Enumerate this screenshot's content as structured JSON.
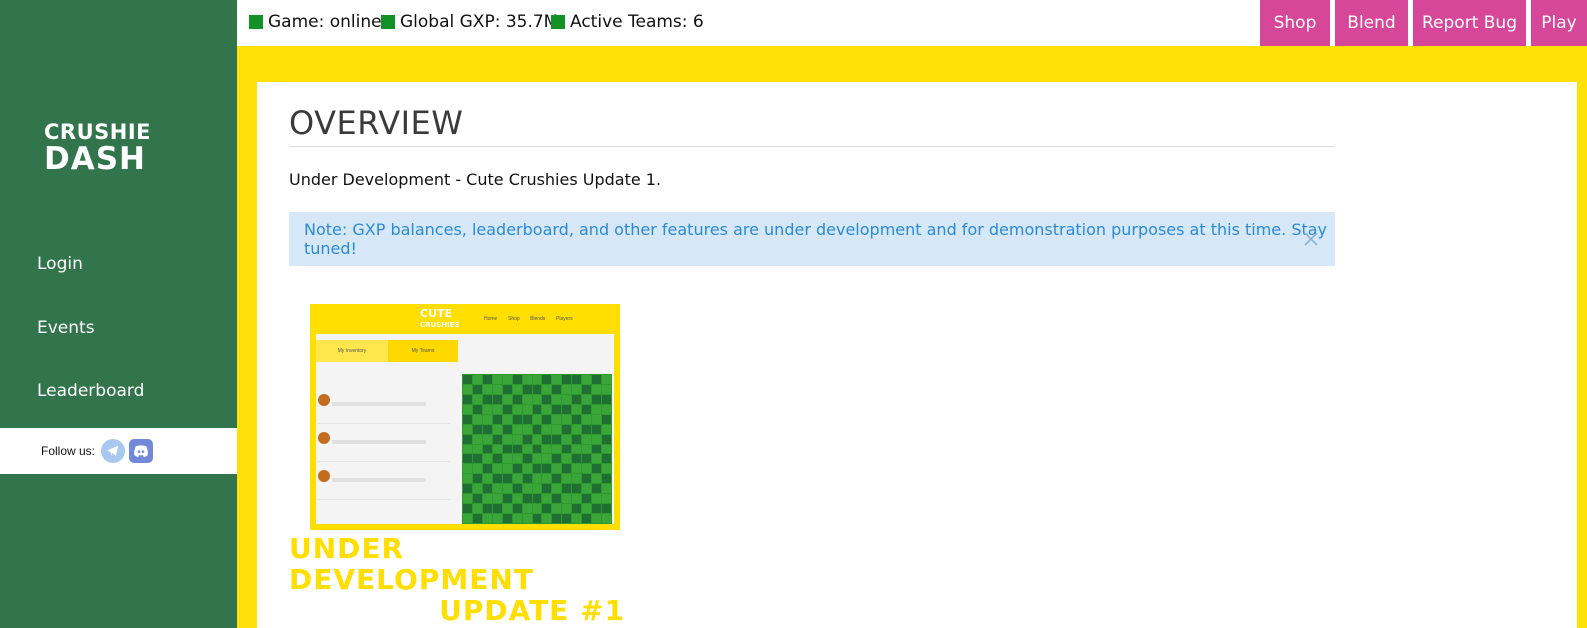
{
  "sidebar": {
    "logo_line1": "CRUSHIE",
    "logo_line2": "DASH",
    "nav": [
      {
        "label": "Login"
      },
      {
        "label": "Events"
      },
      {
        "label": "Leaderboard"
      }
    ],
    "follow_label": "Follow us:"
  },
  "topbar": {
    "stats": [
      {
        "label": "Game: online"
      },
      {
        "label": "Global GXP: 35.7M"
      },
      {
        "label": "Active Teams: 6"
      }
    ],
    "buttons": [
      {
        "label": "Shop"
      },
      {
        "label": "Blend"
      },
      {
        "label": "Report Bug"
      },
      {
        "label": "Play"
      }
    ]
  },
  "main": {
    "title": "OVERVIEW",
    "subtitle": "Under Development - Cute Crushies Update 1.",
    "note": "Note: GXP balances, leaderboard, and other features are under development and for demonstration purposes at this time. Stay tuned!",
    "promo": {
      "line1": "UNDER DEVELOPMENT",
      "line2": "UPDATE #1",
      "shot_logo_line1": "CUTE",
      "shot_logo_line2": "CRUSHIES",
      "shot_nav": [
        "Home",
        "Shop",
        "Blends",
        "Players"
      ],
      "shot_tabs": [
        "My Inventory",
        "My Teams"
      ]
    }
  },
  "colors": {
    "sidebar": "#32744b",
    "background": "#ffe008",
    "button": "#d6479a",
    "status": "#139127",
    "note_bg": "#d6e8f8",
    "note_text": "#2b8ad6"
  }
}
